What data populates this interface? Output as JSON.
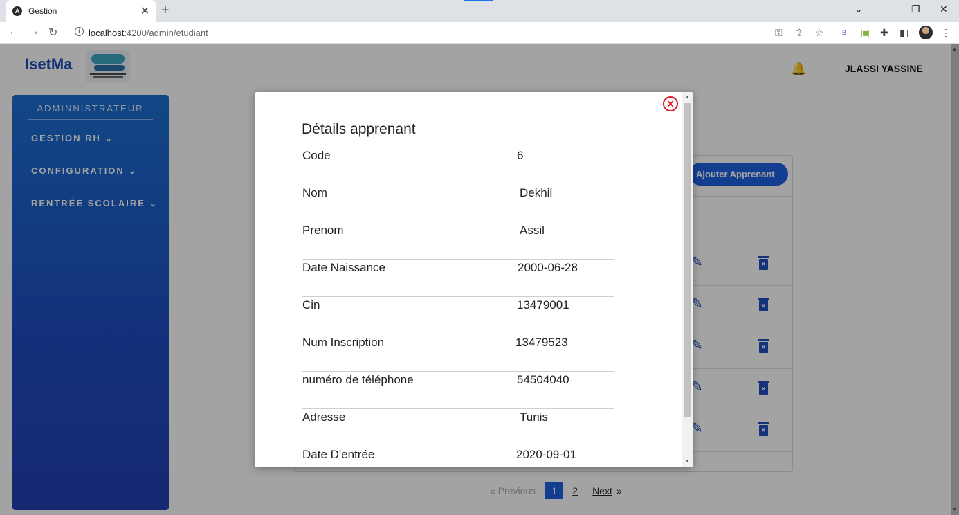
{
  "browser": {
    "tab_title": "Gestion",
    "tab_favicon": "A",
    "url_host": "localhost",
    "url_rest": ":4200/admin/etudiant"
  },
  "app": {
    "brand": "IsetMa",
    "user_name": "JLASSI YASSINE"
  },
  "sidebar": {
    "title": "ADMINNISTRATEUR",
    "items": [
      {
        "label": "GESTION RH"
      },
      {
        "label": "CONFIGURATION"
      },
      {
        "label": "RENTRÉE SCOLAIRE"
      }
    ]
  },
  "main": {
    "add_button": "Ajouter Apprenant"
  },
  "pagination": {
    "previous": "Previous",
    "pages": [
      "1",
      "2"
    ],
    "next": "Next",
    "current_page": 1
  },
  "modal": {
    "title": "Détails apprenant",
    "rows": [
      {
        "label": "Code",
        "value": "6"
      },
      {
        "label": "Nom",
        "value": "Dekhil"
      },
      {
        "label": "Prenom",
        "value": "Assil"
      },
      {
        "label": "Date Naissance",
        "value": "2000-06-28"
      },
      {
        "label": "Cin",
        "value": "13479001"
      },
      {
        "label": "Num Inscription",
        "value": "13479523"
      },
      {
        "label": "numéro de téléphone",
        "value": "54504040"
      },
      {
        "label": "Adresse",
        "value": "Tunis"
      },
      {
        "label": "Date D'entrée",
        "value": "2020-09-01"
      }
    ]
  },
  "colors": {
    "primary": "#1e4fbe",
    "button": "#1e62e0",
    "close": "#e0141e"
  }
}
